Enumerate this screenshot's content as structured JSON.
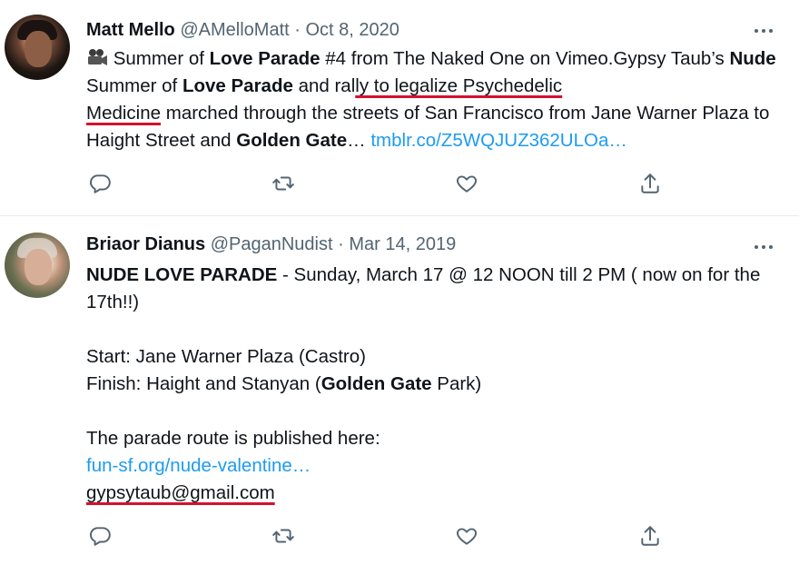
{
  "tweets": [
    {
      "name": "Matt Mello",
      "handle": "@AMelloMatt",
      "sep": "·",
      "date": "Oct 8, 2020",
      "icon": "movie-camera-emoji",
      "text": {
        "p1": "Summer of ",
        "b1": "Love Parade",
        "p2": " #4 from The Naked One on Vimeo.Gypsy Taub’s ",
        "b2": "Nude",
        "p3": " Summer of ",
        "b3": "Love Parade",
        "p4": " and ral",
        "u1": "ly to legalize Psychedelic",
        "u2": "Medicine",
        "p5": " marched through the streets of San Francisco from Jane Warner Plaza to Haight Street and ",
        "b4": "Golden Gate",
        "p6": "… ",
        "link": "tmblr.co/Z5WQJUZ362ULOa…"
      }
    },
    {
      "name": "Briaor Dianus",
      "handle": "@PaganNudist",
      "sep": "·",
      "date": "Mar 14, 2019",
      "text": {
        "b1": "NUDE LOVE PARADE",
        "p1": " - Sunday, March 17 @ 12 NOON till 2 PM ( now on for the 17th!!)",
        "start": "Start: Jane Warner Plaza (Castro)",
        "finish_pre": "Finish: Haight and Stanyan (",
        "finish_b": "Golden Gate",
        "finish_post": " Park)",
        "route": "The parade route is published here:",
        "link": "fun-sf.org/nude-valentine…",
        "email": "gypsytaub@gmail.com"
      }
    }
  ],
  "colors": {
    "link": "#1d9bf0",
    "meta": "#536471",
    "annotation": "#d6102e"
  },
  "icons": [
    "more-icon",
    "reply-icon",
    "retweet-icon",
    "like-icon",
    "share-icon"
  ]
}
